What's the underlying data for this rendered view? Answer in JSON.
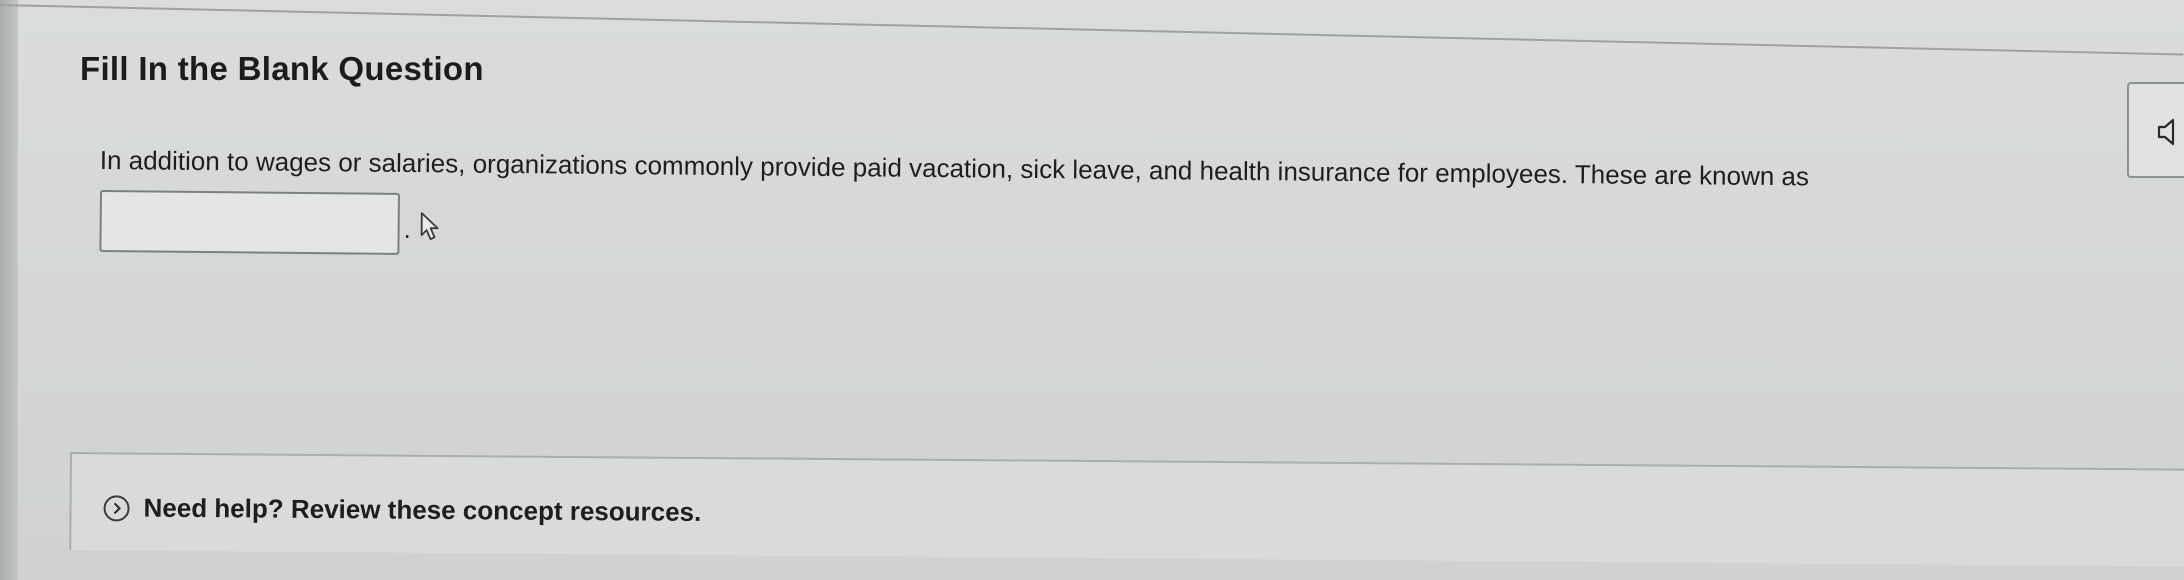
{
  "question": {
    "title": "Fill In the Blank Question",
    "text": "In addition to wages or salaries, organizations commonly provide paid vacation, sick leave, and health insurance for employees. These are known as",
    "blank_value": "",
    "blank_suffix": "."
  },
  "audio": {
    "icon": "speaker-icon"
  },
  "help": {
    "label": "Need help? Review these concept resources.",
    "icon": "chevron-right-icon"
  }
}
